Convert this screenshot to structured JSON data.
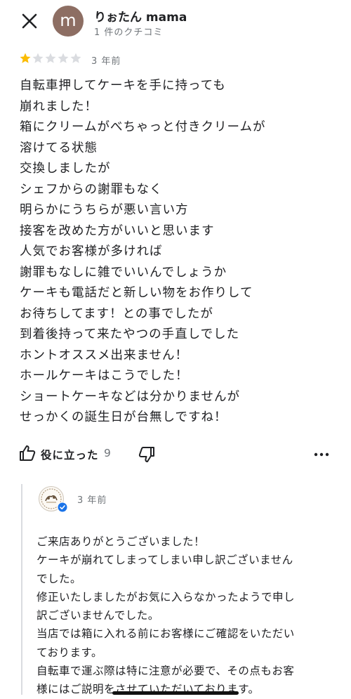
{
  "header": {
    "avatar_letter": "m",
    "user_name": "りぉたん mama",
    "review_count": "1 件のクチコミ"
  },
  "review": {
    "rating": 1,
    "max_rating": 5,
    "star_color": "#fbbc04",
    "empty_star_color": "#dadce0",
    "date": "3 年前",
    "lines": [
      "自転車押してケーキを手に持っても",
      "崩れました！",
      "箱にクリームがべちゃっと付きクリームが",
      "溶けてる状態",
      "交換しましたが",
      "シェフからの謝罪もなく",
      "明らかにうちらが悪い言い方",
      "接客を改めた方がいいと思います",
      "人気でお客様が多ければ",
      "謝罪もなしに雑でいいんでしょうか",
      "ケーキも電話だと新しい物をお作りして",
      "お待ちしてます！との事でしたが",
      "到着後持って来たやつの手直しでした",
      "ホントオススメ出来ません！",
      "ホールケーキはこうでした！",
      "ショートケーキなどは分かりませんが",
      "せっかくの誕生日が台無しですね！"
    ]
  },
  "actions": {
    "helpful_label": "役に立った",
    "helpful_count": "9",
    "icons": [
      "thumb-up-icon",
      "thumb-down-icon",
      "more-horizontal-icon"
    ]
  },
  "owner_reply": {
    "date": "3 年前",
    "verified_color": "#1a73e8",
    "lines": [
      "ご来店ありがとうございました！",
      "ケーキが崩れてしまってしまい申し訳ございません",
      "でした。",
      "修正いたしましたがお気に入らなかったようで申し",
      "訳ございませんでした。",
      "当店では箱に入れる前にお客様にご確認をいただい",
      "ております。",
      "自転車で運ぶ際は特に注意が必要で、その点もお客",
      "様にはご説明をさせていただいております。"
    ]
  }
}
